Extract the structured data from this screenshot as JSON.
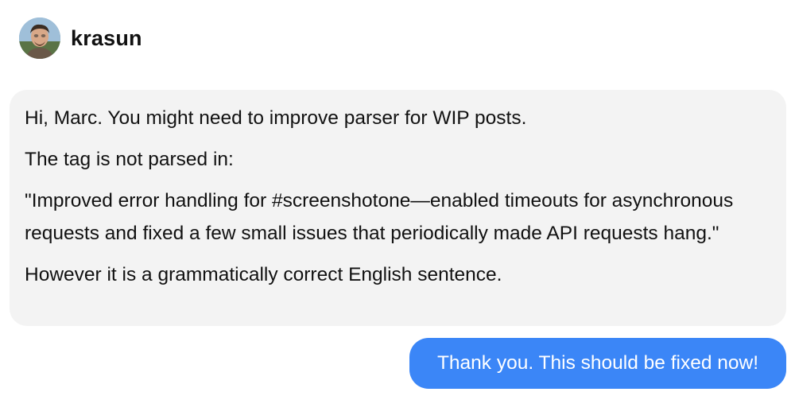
{
  "header": {
    "username": "krasun",
    "avatar_icon": "user-avatar-photo"
  },
  "messages": {
    "incoming": {
      "paragraphs": [
        "Hi, Marc. You might need to improve parser for WIP posts.",
        "The tag is not parsed in:",
        "\"Improved error handling for #screenshotone—enabled timeouts for asynchronous requests and fixed a few small issues that periodically made API requests hang.\"",
        "However it is a grammatically correct English sentence."
      ]
    },
    "outgoing": {
      "text": "Thank you. This should be fixed now!"
    }
  },
  "colors": {
    "incoming_bubble": "#f3f3f3",
    "outgoing_bubble": "#3b86f7",
    "outgoing_text": "#ffffff"
  }
}
